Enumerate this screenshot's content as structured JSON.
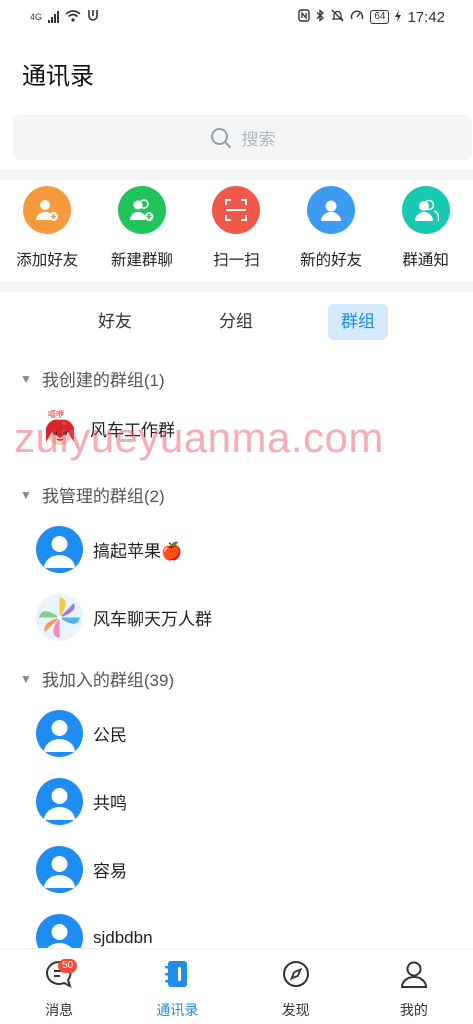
{
  "status_bar": {
    "network": "4G",
    "battery": "64",
    "time": "17:42"
  },
  "header": {
    "title": "通讯录"
  },
  "search": {
    "placeholder": "搜索"
  },
  "quick_actions": [
    {
      "label": "添加好友",
      "icon": "add-friend-icon",
      "color": "#f79a3e"
    },
    {
      "label": "新建群聊",
      "icon": "new-group-icon",
      "color": "#21c45a"
    },
    {
      "label": "扫一扫",
      "icon": "scan-icon",
      "color": "#f1584a"
    },
    {
      "label": "新的好友",
      "icon": "new-friend-icon",
      "color": "#3d9af2"
    },
    {
      "label": "群通知",
      "icon": "group-notice-icon",
      "color": "#19c8b1"
    }
  ],
  "tabs": [
    {
      "label": "好友",
      "active": false
    },
    {
      "label": "分组",
      "active": false
    },
    {
      "label": "群组",
      "active": true
    }
  ],
  "sections": [
    {
      "title": "我创建的群组(1)",
      "groups": [
        {
          "name": "风车工作群",
          "avatar": "cartoon-avatar"
        }
      ]
    },
    {
      "title": "我管理的群组(2)",
      "groups": [
        {
          "name": "搞起苹果🍎",
          "avatar": "default-avatar"
        },
        {
          "name": "风车聊天万人群",
          "avatar": "pinwheel-avatar"
        }
      ]
    },
    {
      "title": "我加入的群组(39)",
      "groups": [
        {
          "name": "公民",
          "avatar": "default-avatar"
        },
        {
          "name": "共鸣",
          "avatar": "default-avatar"
        },
        {
          "name": "容易",
          "avatar": "default-avatar"
        },
        {
          "name": "sjdbdbn",
          "avatar": "default-avatar"
        }
      ]
    }
  ],
  "watermark": "zuiyueyuanma.com",
  "bottom_nav": [
    {
      "label": "消息",
      "icon": "message-icon",
      "badge": "50",
      "active": false
    },
    {
      "label": "通讯录",
      "icon": "contacts-icon",
      "active": true
    },
    {
      "label": "发现",
      "icon": "compass-icon",
      "active": false
    },
    {
      "label": "我的",
      "icon": "profile-icon",
      "active": false
    }
  ],
  "colors": {
    "accent": "#1f8ce6",
    "tab_active_bg": "#d5ebfb",
    "avatar_blue": "#1e8cf0"
  }
}
